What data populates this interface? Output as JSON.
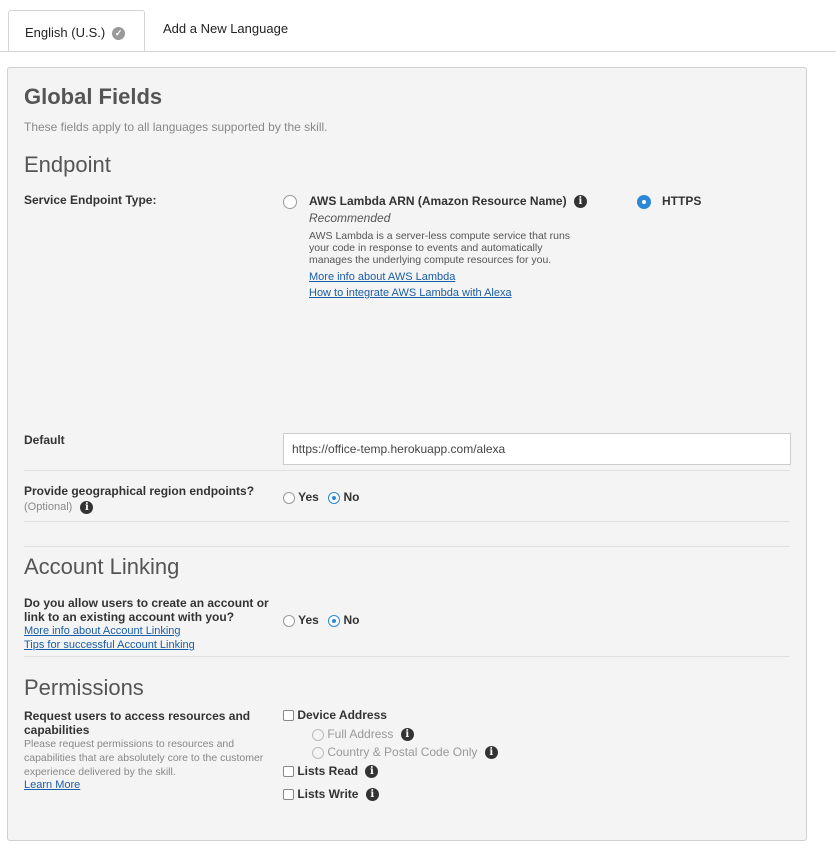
{
  "tabs": [
    {
      "label": "English (U.S.)"
    },
    {
      "label": "Add a New Language"
    }
  ],
  "global": {
    "title": "Global Fields",
    "subtitle": "These fields apply to all languages supported by the skill."
  },
  "endpoint": {
    "heading": "Endpoint",
    "type_label": "Service Endpoint Type:",
    "lambda_option": "AWS Lambda ARN (Amazon Resource Name)",
    "recommended": "Recommended",
    "lambda_desc": "AWS Lambda is a server-less compute service that runs your code in response to events and automatically manages the underlying compute resources for you.",
    "link_more": "More info about AWS Lambda",
    "link_integrate": "How to integrate AWS Lambda with Alexa",
    "https_option": "HTTPS",
    "selected": "HTTPS",
    "default_label": "Default",
    "default_value": "https://office-temp.herokuapp.com/alexa",
    "geo_label": "Provide geographical region endpoints?",
    "geo_optional": "(Optional)",
    "geo_yes": "Yes",
    "geo_no": "No",
    "geo_selected": "No"
  },
  "account_linking": {
    "heading": "Account Linking",
    "question": "Do you allow users to create an account or link to an existing account with you?",
    "link_more": "More info about Account Linking",
    "link_tips": "Tips for successful Account Linking",
    "yes": "Yes",
    "no": "No",
    "selected": "No"
  },
  "permissions": {
    "heading": "Permissions",
    "request_label": "Request users to access resources and capabilities",
    "request_desc": "Please request permissions to resources and capabilities that are absolutely core to the customer experience delivered by the skill.",
    "learn_more": "Learn More",
    "device_address": "Device Address",
    "full_address": "Full Address",
    "country_postal": "Country & Postal Code Only",
    "lists_read": "Lists Read",
    "lists_write": "Lists Write"
  },
  "icons": {
    "check": "check-circle-icon",
    "info": "info-icon"
  },
  "colors": {
    "accent": "#2b88d8",
    "link": "#1a5ea8"
  }
}
